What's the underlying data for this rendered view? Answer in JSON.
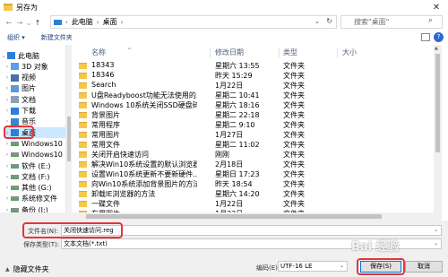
{
  "window": {
    "title": "另存为",
    "close": "✕"
  },
  "address": {
    "crumbs": [
      "此电脑",
      "桌面"
    ],
    "search_placeholder": "搜索\"桌面\""
  },
  "toolbar": {
    "organize": "组织 ▾",
    "new_folder": "新建文件夹",
    "help": "?"
  },
  "nav": {
    "items": [
      {
        "label": "此电脑",
        "icon": "pc-icon",
        "chev": "⌄",
        "indent": 0
      },
      {
        "label": "3D 对象",
        "icon": "cube-icon",
        "chev": "›",
        "indent": 1
      },
      {
        "label": "视频",
        "icon": "video-icon",
        "chev": "›",
        "indent": 1
      },
      {
        "label": "图片",
        "icon": "picture-icon",
        "chev": "›",
        "indent": 1
      },
      {
        "label": "文档",
        "icon": "document-icon",
        "chev": "›",
        "indent": 1
      },
      {
        "label": "下载",
        "icon": "download-icon",
        "chev": "›",
        "indent": 1
      },
      {
        "label": "音乐",
        "icon": "music-icon",
        "chev": "›",
        "indent": 1
      },
      {
        "label": "桌面",
        "icon": "desktop-icon",
        "chev": "›",
        "indent": 1,
        "selected": true
      },
      {
        "label": "Windows10",
        "icon": "drive-icon",
        "chev": "›",
        "indent": 1
      },
      {
        "label": "Windows10",
        "icon": "drive-icon",
        "chev": "›",
        "indent": 1
      },
      {
        "label": "软件 (E:)",
        "icon": "drive-icon",
        "chev": "›",
        "indent": 1
      },
      {
        "label": "文档 (F:)",
        "icon": "drive-icon",
        "chev": "›",
        "indent": 1
      },
      {
        "label": "其他 (G:)",
        "icon": "drive-icon",
        "chev": "›",
        "indent": 1
      },
      {
        "label": "系统修文件",
        "icon": "drive-icon",
        "chev": "›",
        "indent": 1
      },
      {
        "label": "备份 (I:)",
        "icon": "drive-icon",
        "chev": "›",
        "indent": 1
      }
    ]
  },
  "columns": {
    "name": "名称",
    "date": "修改日期",
    "type": "类型",
    "size": "大小",
    "sort_caret": "^"
  },
  "files": [
    {
      "name": "18343",
      "date": "星期六 13:55",
      "type": "文件夹"
    },
    {
      "name": "18346",
      "date": "昨天 15:29",
      "type": "文件夹"
    },
    {
      "name": "Search",
      "date": "1月22日",
      "type": "文件夹"
    },
    {
      "name": "U盘Readyboost功能无法使用的...",
      "date": "星期二 10:41",
      "type": "文件夹"
    },
    {
      "name": "Windows 10系统关闭SSD硬盘碎...",
      "date": "星期六 18:16",
      "type": "文件夹"
    },
    {
      "name": "背景图片",
      "date": "星期二 22:18",
      "type": "文件夹"
    },
    {
      "name": "常用程序",
      "date": "星期二 9:10",
      "type": "文件夹"
    },
    {
      "name": "常用图片",
      "date": "1月27日",
      "type": "文件夹"
    },
    {
      "name": "常用文件",
      "date": "星期二 11:02",
      "type": "文件夹"
    },
    {
      "name": "关闭开启快速访问",
      "date": "刚刚",
      "type": "文件夹"
    },
    {
      "name": "解决Win10系统设置的默认浏览器...",
      "date": "2月18日",
      "type": "文件夹"
    },
    {
      "name": "设置Win10系统更新不要新硬件...",
      "date": "星期日 17:23",
      "type": "文件夹"
    },
    {
      "name": "向Win10系统添加背景图片的方法",
      "date": "昨天 18:54",
      "type": "文件夹"
    },
    {
      "name": "卸载IE浏览器的方法",
      "date": "星期六 14:20",
      "type": "文件夹"
    },
    {
      "name": "一碟文件",
      "date": "1月22日",
      "type": "文件夹"
    },
    {
      "name": "有用图片",
      "date": "1月22日",
      "type": "文件夹"
    }
  ],
  "form": {
    "filename_label": "文件名(N):",
    "filename_value": "关闭快速访问.reg",
    "savetype_label": "保存类型(T):",
    "savetype_value": "文本文档(*.txt)",
    "encoding_label": "编码(E):",
    "encoding_value": "UTF-16 LE",
    "save_button": "保存(S)",
    "cancel_button": "取消",
    "hide_folders": "隐藏文件夹",
    "dropdown": "⌄"
  },
  "colors": {
    "highlight": "#e4353b",
    "selected": "#cce8ff",
    "folder": "#f6c849"
  },
  "watermark": "Bai 经验"
}
